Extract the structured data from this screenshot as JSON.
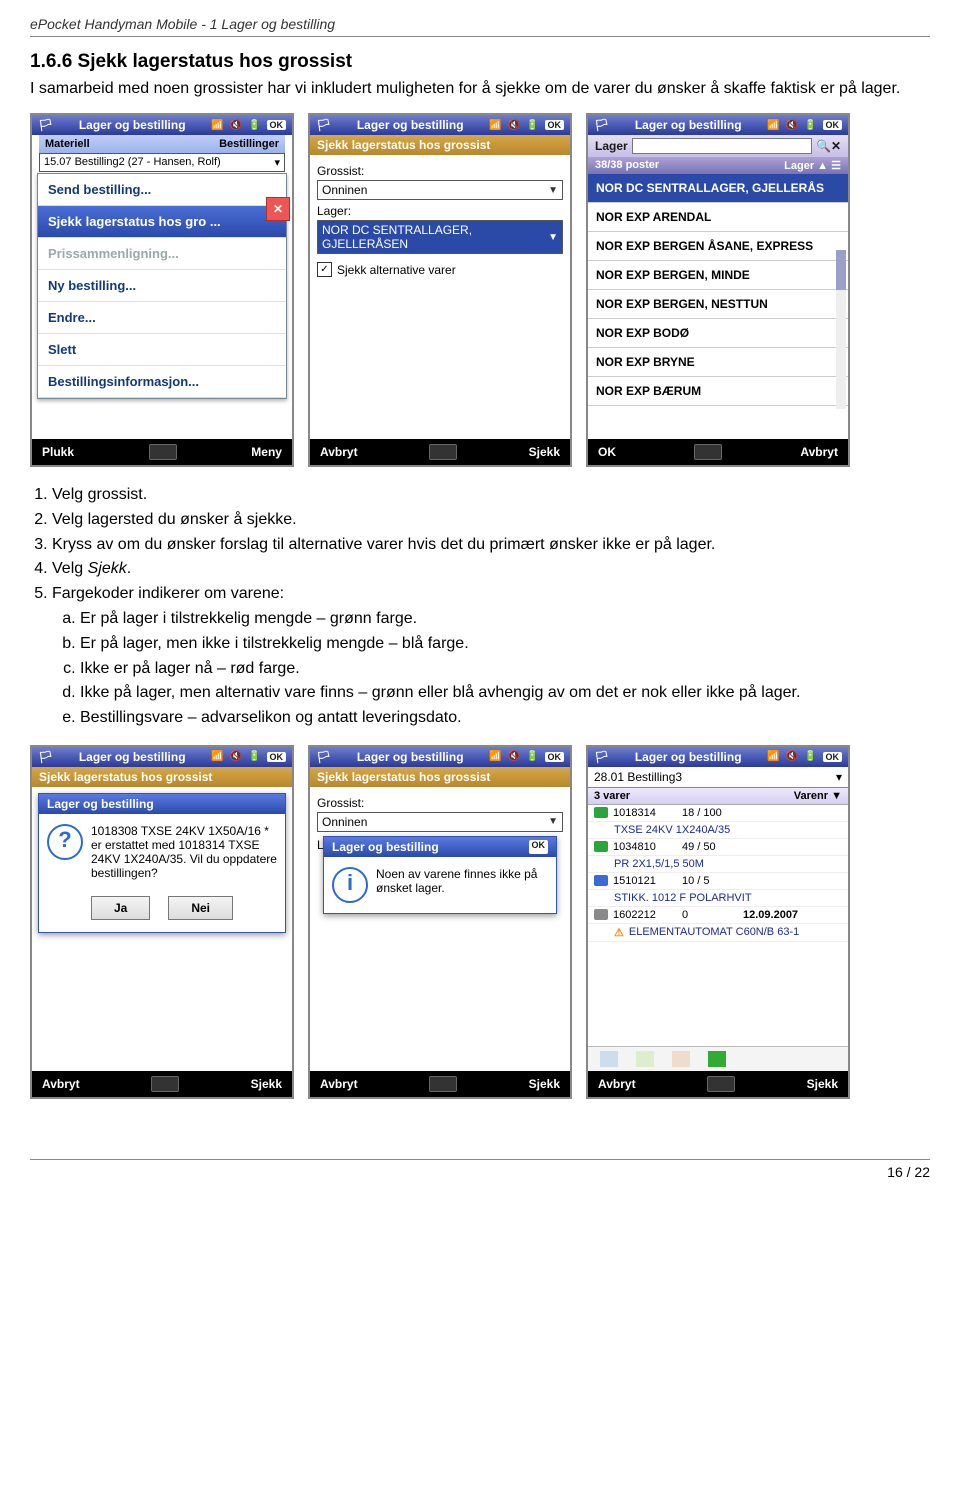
{
  "doc": {
    "header": "ePocket Handyman Mobile - 1 Lager og bestilling",
    "page": "16 / 22",
    "section_title": "1.6.6 Sjekk lagerstatus hos grossist",
    "intro": "I samarbeid med noen grossister har vi inkludert muligheten for å sjekke om de varer du ønsker å skaffe faktisk er på lager."
  },
  "steps": {
    "s1": "Velg grossist.",
    "s2": "Velg lagersted du ønsker å sjekke.",
    "s3": "Kryss av om du ønsker forslag til alternative varer hvis det du primært ønsker ikke er på lager.",
    "s4_pre": "Velg ",
    "s4_em": "Sjekk",
    "s4_post": ".",
    "s5": "Fargekoder indikerer om varene:",
    "s5a": "Er på lager i tilstrekkelig mengde – grønn farge.",
    "s5b": "Er på lager, men ikke i tilstrekkelig mengde – blå farge.",
    "s5c": "Ikke er på lager nå – rød farge.",
    "s5d": "Ikke på lager, men alternativ vare finns – grønn eller blå avhengig av om det er nok eller ikke på lager.",
    "s5e": "Bestillingsvare – advarselikon og antatt leveringsdato."
  },
  "common": {
    "app_title": "Lager og bestilling",
    "ok": "OK",
    "avbryt": "Avbryt",
    "sjekk": "Sjekk",
    "plukk": "Plukk",
    "meny": "Meny"
  },
  "shot1": {
    "tab_materiell": "Materiell",
    "tab_bestillinger": "Bestillinger",
    "dd_value": "15.07 Bestilling2 (27 - Hansen, Rolf)",
    "menu": {
      "send": "Send bestilling...",
      "sjekk": "Sjekk lagerstatus hos gro ...",
      "pris": "Prissammenligning...",
      "ny": "Ny bestilling...",
      "endre": "Endre...",
      "slett": "Slett",
      "info": "Bestillingsinformasjon..."
    }
  },
  "shot2": {
    "subtitle": "Sjekk lagerstatus hos grossist",
    "lbl_grossist": "Grossist:",
    "val_grossist": "Onninen",
    "lbl_lager": "Lager:",
    "val_lager": "NOR DC SENTRALLAGER, GJELLERÅSEN",
    "chk_label": "Sjekk alternative varer"
  },
  "shot3": {
    "sub_lager": "Lager",
    "count": "38/38 poster",
    "sort": "Lager ▲",
    "rows": [
      "NOR DC SENTRALLAGER, GJELLERÅS",
      "NOR EXP ARENDAL",
      "NOR EXP BERGEN ÅSANE, EXPRESS",
      "NOR EXP BERGEN, MINDE",
      "NOR EXP BERGEN, NESTTUN",
      "NOR EXP BODØ",
      "NOR EXP BRYNE",
      "NOR EXP BÆRUM"
    ]
  },
  "shot4": {
    "dlg_title": "Lager og bestilling",
    "dlg_text": "1018308 TXSE 24KV 1X50A/16      * er erstattet med 1018314 TXSE 24KV 1X240A/35. Vil du oppdatere bestillingen?",
    "btn_ja": "Ja",
    "btn_nei": "Nei"
  },
  "shot5": {
    "dlg_title": "Lager og bestilling",
    "dlg_text": "Noen av varene finnes ikke på ønsket lager."
  },
  "shot6": {
    "header": "28.01 Bestilling3",
    "count": "3 varer",
    "sort": "Varenr ▼",
    "rows": [
      {
        "icon": "g",
        "code": "1018314",
        "qty": "18 / 100",
        "desc": "TXSE 24KV 1X240A/35",
        "desc_class": "green-t"
      },
      {
        "icon": "g",
        "code": "1034810",
        "qty": "49 / 50",
        "desc": "PR 2X1,5/1,5    50M",
        "desc_class": "blue-t"
      },
      {
        "icon": "b",
        "code": "1510121",
        "qty": "10 / 5",
        "desc": "STIKK. 1012 F POLARHVIT",
        "desc_class": "blue-t"
      },
      {
        "icon": "gr",
        "code": "1602212",
        "qty": "0",
        "date": "12.09.2007",
        "warn": true,
        "desc": "ELEMENTAUTOMAT C60N/B 63-1",
        "desc_class": ""
      }
    ]
  }
}
